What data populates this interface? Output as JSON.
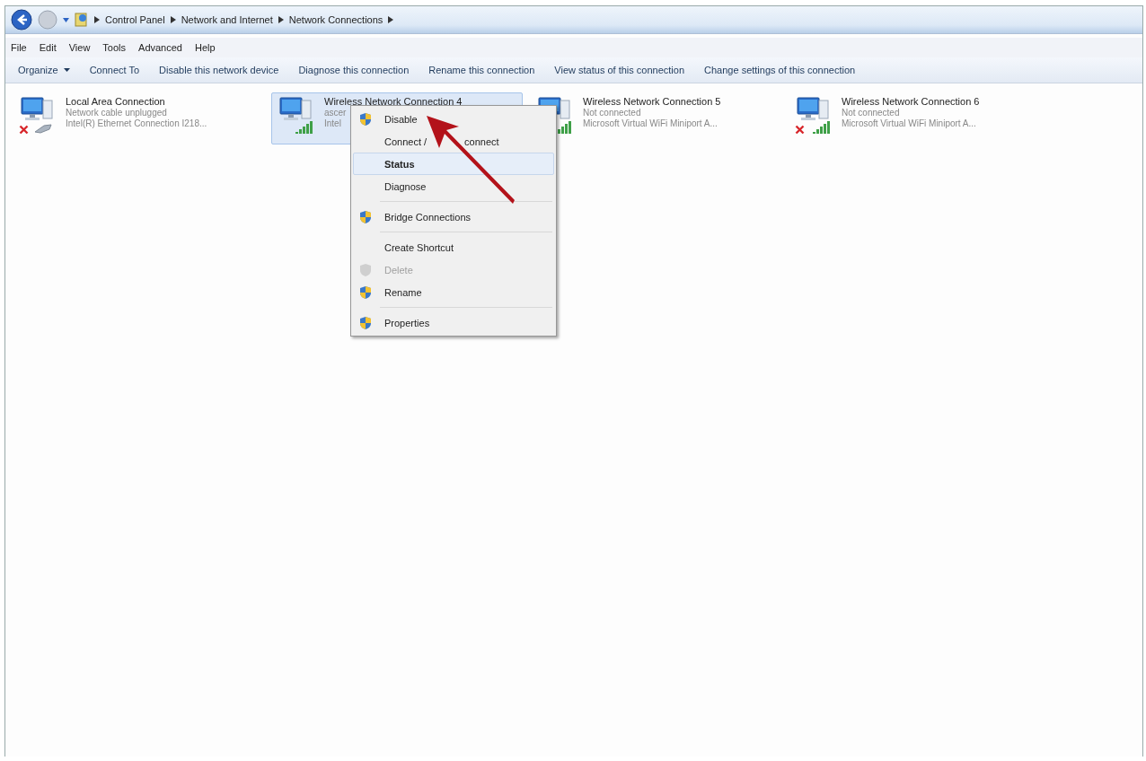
{
  "address_bar": {
    "crumbs": [
      "Control Panel",
      "Network and Internet",
      "Network Connections"
    ]
  },
  "menu_bar": [
    "File",
    "Edit",
    "View",
    "Tools",
    "Advanced",
    "Help"
  ],
  "command_bar": [
    {
      "label": "Organize",
      "dropdown": true
    },
    {
      "label": "Connect To",
      "dropdown": false
    },
    {
      "label": "Disable this network device",
      "dropdown": false
    },
    {
      "label": "Diagnose this connection",
      "dropdown": false
    },
    {
      "label": "Rename this connection",
      "dropdown": false
    },
    {
      "label": "View status of this connection",
      "dropdown": false
    },
    {
      "label": "Change settings of this connection",
      "dropdown": false
    }
  ],
  "connections": [
    {
      "name": "Local Area Connection",
      "status": "Network cable unplugged",
      "device": "Intel(R) Ethernet Connection I218...",
      "kind": "ethernet",
      "disconnected": true,
      "selected": false
    },
    {
      "name": "Wireless Network Connection 4",
      "status": "ascer",
      "device": "Intel",
      "kind": "wireless",
      "disconnected": false,
      "selected": true
    },
    {
      "name": "Wireless Network Connection 5",
      "status": "Not connected",
      "device": "Microsoft Virtual WiFi Miniport A...",
      "kind": "wireless",
      "disconnected": false,
      "selected": false
    },
    {
      "name": "Wireless Network Connection 6",
      "status": "Not connected",
      "device": "Microsoft Virtual WiFi Miniport A...",
      "kind": "wireless",
      "disconnected": true,
      "selected": false
    }
  ],
  "context_menu": [
    {
      "label": "Disable",
      "kind": "shield",
      "bold": false,
      "disabled": false,
      "selected": false,
      "separator_after": false
    },
    {
      "label": "Connect /",
      "label_tail": "connect",
      "kind": "plain",
      "bold": false,
      "disabled": false,
      "selected": false,
      "separator_after": false
    },
    {
      "label": "Status",
      "kind": "plain",
      "bold": true,
      "disabled": false,
      "selected": true,
      "separator_after": false
    },
    {
      "label": "Diagnose",
      "kind": "plain",
      "bold": false,
      "disabled": false,
      "selected": false,
      "separator_after": true
    },
    {
      "label": "Bridge Connections",
      "kind": "shield",
      "bold": false,
      "disabled": false,
      "selected": false,
      "separator_after": true
    },
    {
      "label": "Create Shortcut",
      "kind": "plain",
      "bold": false,
      "disabled": false,
      "selected": false,
      "separator_after": false
    },
    {
      "label": "Delete",
      "kind": "shield",
      "bold": false,
      "disabled": true,
      "selected": false,
      "separator_after": false
    },
    {
      "label": "Rename",
      "kind": "shield",
      "bold": false,
      "disabled": false,
      "selected": false,
      "separator_after": true
    },
    {
      "label": "Properties",
      "kind": "shield",
      "bold": false,
      "disabled": false,
      "selected": false,
      "separator_after": false
    }
  ]
}
